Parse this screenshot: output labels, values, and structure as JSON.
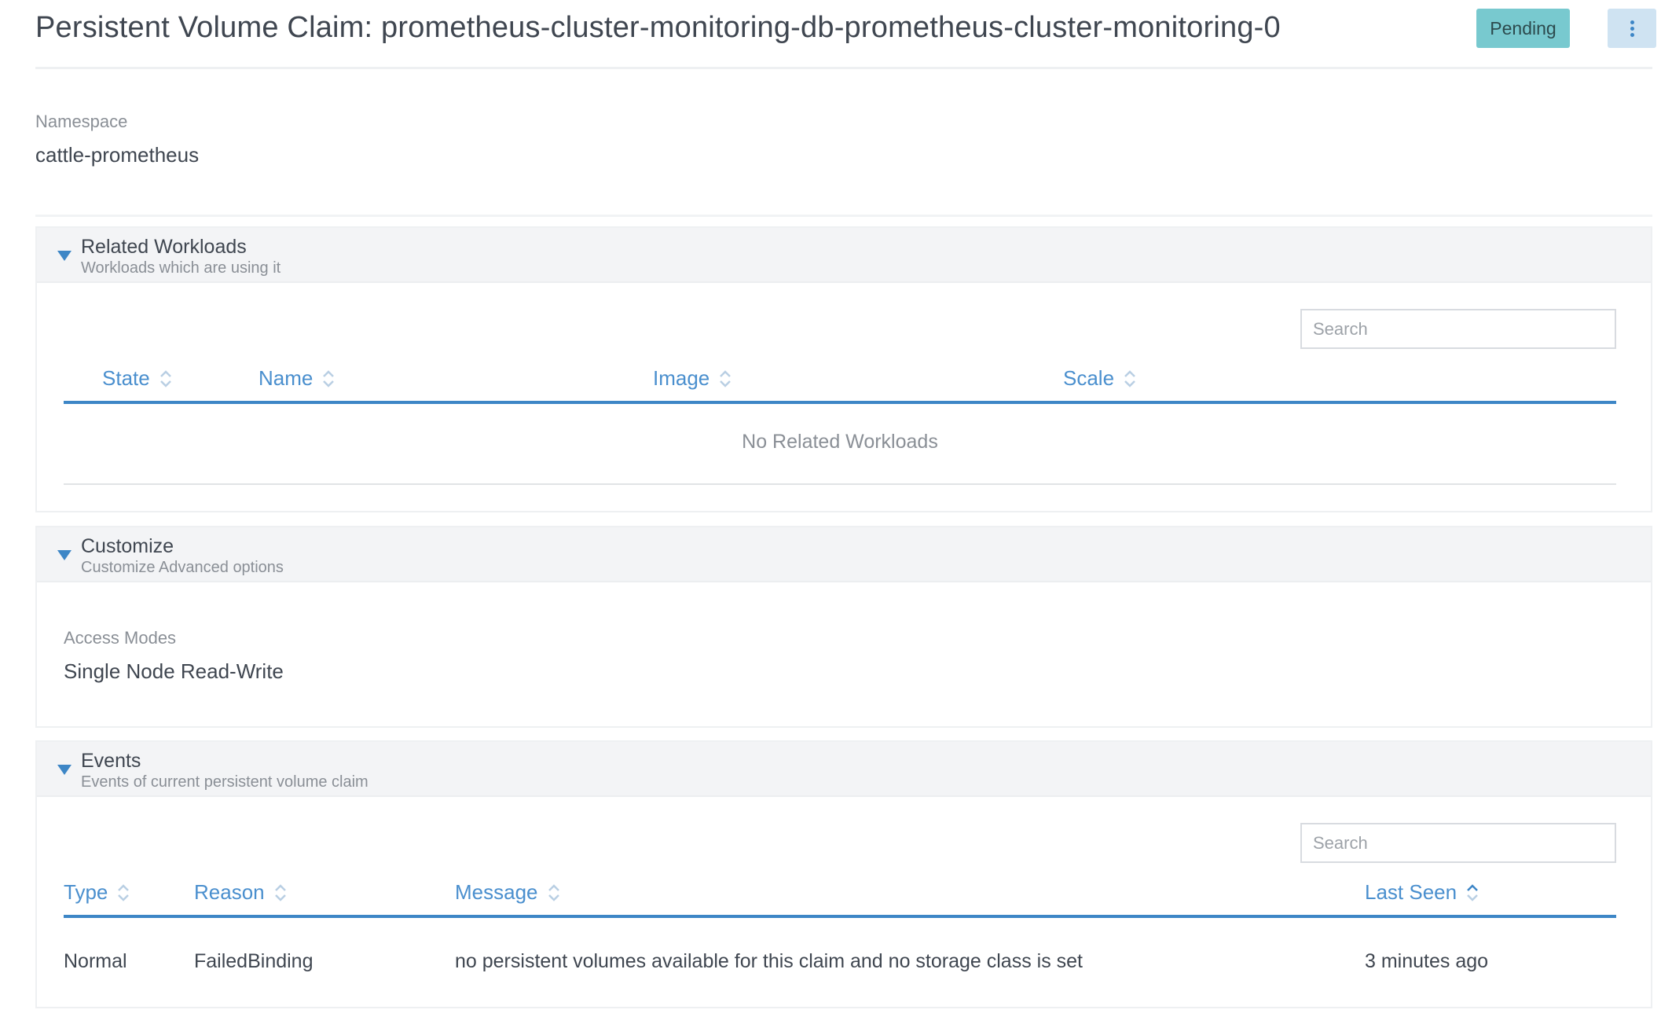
{
  "header": {
    "title": "Persistent Volume Claim: prometheus-cluster-monitoring-db-prometheus-cluster-monitoring-0",
    "status": "Pending",
    "more_icon": "vertical-ellipsis-icon"
  },
  "namespace": {
    "label": "Namespace",
    "value": "cattle-prometheus"
  },
  "related_workloads": {
    "title": "Related Workloads",
    "subtitle": "Workloads which are using it",
    "search_placeholder": "Search",
    "columns": [
      "State",
      "Name",
      "Image",
      "Scale"
    ],
    "empty_message": "No Related Workloads"
  },
  "customize": {
    "title": "Customize",
    "subtitle": "Customize Advanced options",
    "access_modes_label": "Access Modes",
    "access_modes_value": "Single Node Read-Write"
  },
  "events": {
    "title": "Events",
    "subtitle": "Events of current persistent volume claim",
    "search_placeholder": "Search",
    "columns": [
      "Type",
      "Reason",
      "Message",
      "Last Seen"
    ],
    "rows": [
      {
        "type": "Normal",
        "reason": "FailedBinding",
        "message": "no persistent volumes available for this claim and no storage class is set",
        "last_seen": "3 minutes ago"
      }
    ]
  },
  "colors": {
    "accent": "#3d86c6",
    "status_pending": "#78c9cf",
    "header_link": "#4a8fce"
  }
}
